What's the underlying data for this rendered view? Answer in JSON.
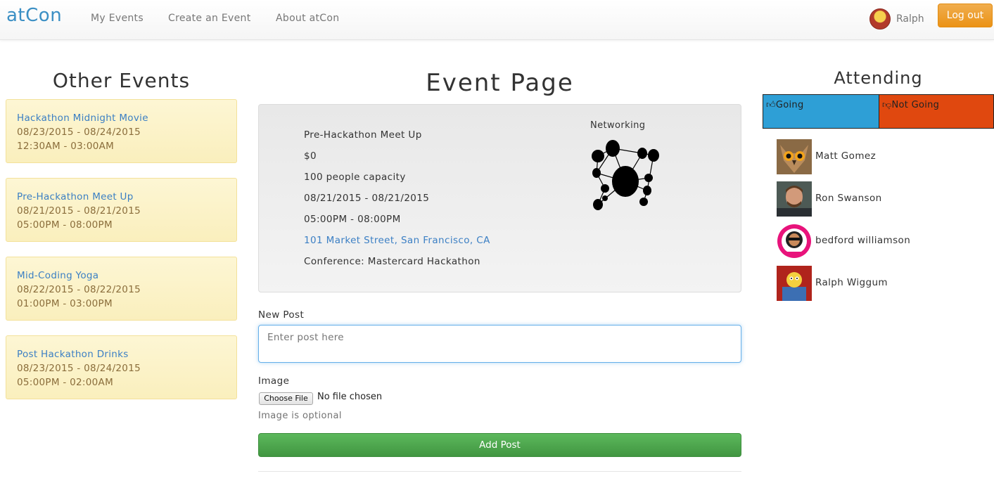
{
  "nav": {
    "brand": "atCon",
    "links": [
      "My Events",
      "Create an Event",
      "About atCon"
    ],
    "user_name": "Ralph",
    "logout_label": "Log out"
  },
  "other_events": {
    "title": "Other Events",
    "items": [
      {
        "name": "Hackathon Midnight Movie",
        "dates": "08/23/2015 - 08/24/2015",
        "times": "12:30AM - 03:00AM"
      },
      {
        "name": "Pre-Hackathon Meet Up",
        "dates": "08/21/2015 - 08/21/2015",
        "times": "05:00PM - 08:00PM"
      },
      {
        "name": "Mid-Coding Yoga",
        "dates": "08/22/2015 - 08/22/2015",
        "times": "01:00PM - 03:00PM"
      },
      {
        "name": "Post Hackathon Drinks",
        "dates": "08/23/2015 - 08/24/2015",
        "times": "05:00PM - 02:00AM"
      }
    ]
  },
  "event": {
    "page_title": "Event Page",
    "name": "Pre-Hackathon Meet Up",
    "price": "$0",
    "capacity": "100 people capacity",
    "dates": "08/21/2015 - 08/21/2015",
    "times": "05:00PM - 08:00PM",
    "location": "101 Market Street, San Francisco, CA",
    "conference": "Conference: Mastercard Hackathon",
    "category": "Networking",
    "category_icon": "network-icon"
  },
  "post_form": {
    "post_label": "New Post",
    "post_placeholder": "Enter post here",
    "image_label": "Image",
    "choose_file_label": "Choose File",
    "file_status": "No file chosen",
    "image_help": "Image is optional",
    "submit_label": "Add Post"
  },
  "attending": {
    "title": "Attending",
    "going_label": "Going",
    "not_going_label": "Not Going",
    "going_color": "#2e9fd6",
    "not_going_color": "#e0480f",
    "attendees": [
      {
        "name": "Matt Gomez",
        "avatar": "owl-avatar"
      },
      {
        "name": "Ron Swanson",
        "avatar": "man-avatar"
      },
      {
        "name": "bedford williamson",
        "avatar": "badge-avatar"
      },
      {
        "name": "Ralph Wiggum",
        "avatar": "cartoon-avatar"
      }
    ]
  },
  "colors": {
    "brand": "#3b8fc4",
    "link": "#3b7fc4",
    "logout": "#eb9316",
    "add_post": "#5cb85c",
    "event_card_bg": "#fcf8e3"
  }
}
